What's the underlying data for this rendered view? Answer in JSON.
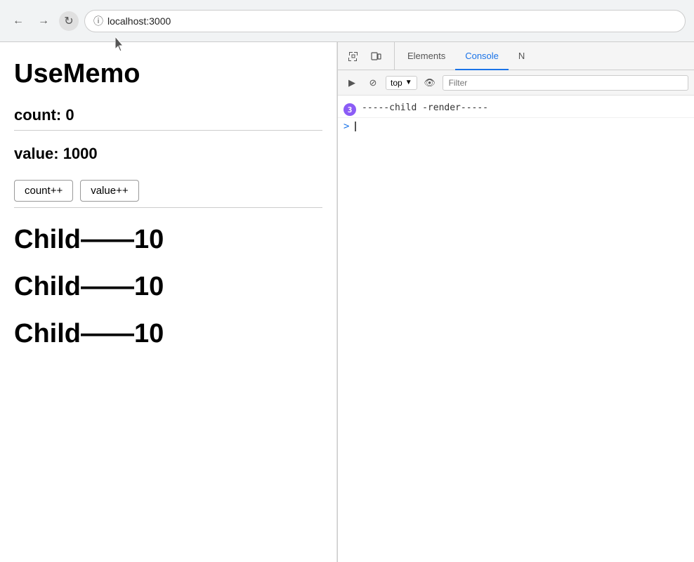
{
  "browser": {
    "url": "localhost:3000",
    "back_label": "←",
    "forward_label": "→",
    "reload_label": "↻"
  },
  "devtools": {
    "tabs": [
      {
        "id": "elements",
        "label": "Elements",
        "active": false
      },
      {
        "id": "console",
        "label": "Console",
        "active": true
      },
      {
        "id": "network",
        "label": "N",
        "active": false
      }
    ],
    "toolbar": {
      "top_label": "top",
      "filter_placeholder": "Filter"
    },
    "console_logs": [
      {
        "count": 3,
        "text": "-----child -render-----"
      }
    ],
    "prompt_symbol": ">"
  },
  "app": {
    "title": "UseMemo",
    "count_label": "count: 0",
    "value_label": "value: 1000",
    "buttons": [
      {
        "id": "count-btn",
        "label": "count++"
      },
      {
        "id": "value-btn",
        "label": "value++"
      }
    ],
    "children": [
      {
        "id": "child-1",
        "label": "Child——10"
      },
      {
        "id": "child-2",
        "label": "Child——10"
      },
      {
        "id": "child-3",
        "label": "Child——10"
      }
    ]
  }
}
